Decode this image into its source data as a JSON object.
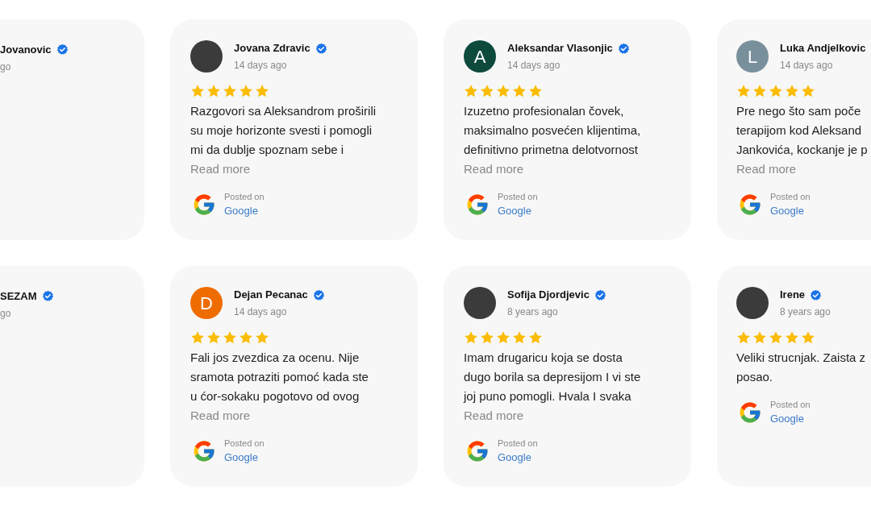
{
  "rows": [
    {
      "cards": [
        {
          "kind": "cut-left",
          "name": "Jovanovic",
          "verified": true,
          "time": "go"
        },
        {
          "kind": "full",
          "avatar": {
            "kind": "photo"
          },
          "name": "Jovana Zdravic",
          "verified": true,
          "time": "14 days ago",
          "stars": 5,
          "lines": [
            "Razgovori sa Aleksandrom proširili",
            "su moje horizonte svesti i pomogli",
            "mi da dublje spoznam sebe i"
          ],
          "read_more": "Read more",
          "posted_on": "Posted on",
          "source": "Google"
        },
        {
          "kind": "full",
          "avatar": {
            "kind": "letter",
            "letter": "A",
            "color": "#0d4a3c"
          },
          "name": "Aleksandar Vlasonjic",
          "verified": true,
          "time": "14 days ago",
          "stars": 5,
          "lines": [
            "Izuzetno profesionalan čovek,",
            "maksimalno posvećen klijentima,",
            "definitivno primetna delotvornost"
          ],
          "read_more": "Read more",
          "posted_on": "Posted on",
          "source": "Google"
        },
        {
          "kind": "cut-right",
          "avatar": {
            "kind": "letter",
            "letter": "L",
            "color": "#78909c"
          },
          "name": "Luka Andjelkovic",
          "verified": false,
          "time": "14 days ago",
          "stars": 5,
          "lines": [
            "Pre nego što sam poče",
            "terapijom kod Aleksand",
            "Jankovića, kockanje je p"
          ],
          "read_more": "Read more",
          "posted_on": "Posted on",
          "source": "Google"
        }
      ]
    },
    {
      "cards": [
        {
          "kind": "cut-left",
          "name": "SEZAM",
          "verified": true,
          "time": "go"
        },
        {
          "kind": "full",
          "avatar": {
            "kind": "letter",
            "letter": "D",
            "color": "#ef6c00"
          },
          "name": "Dejan Pecanac",
          "verified": true,
          "time": "14 days ago",
          "stars": 5,
          "lines": [
            "Fali jos zvezdica za ocenu. Nije",
            "sramota potraziti pomoć kada ste",
            "u ćor-sokaku pogotovo od ovog"
          ],
          "read_more": "Read more",
          "posted_on": "Posted on",
          "source": "Google"
        },
        {
          "kind": "full",
          "avatar": {
            "kind": "photo"
          },
          "name": "Sofija Djordjevic",
          "verified": true,
          "time": "8 years ago",
          "stars": 5,
          "lines": [
            "Imam drugaricu koja se dosta",
            "dugo borila sa depresijom I vi ste",
            "joj puno pomogli. Hvala I svaka"
          ],
          "read_more": "Read more",
          "posted_on": "Posted on",
          "source": "Google"
        },
        {
          "kind": "cut-right",
          "avatar": {
            "kind": "photo"
          },
          "name": "Irene",
          "verified": true,
          "time": "8 years ago",
          "stars": 5,
          "lines": [
            "Veliki strucnjak. Zaista z",
            "posao."
          ],
          "posted_on": "Posted on",
          "source": "Google"
        }
      ]
    }
  ]
}
